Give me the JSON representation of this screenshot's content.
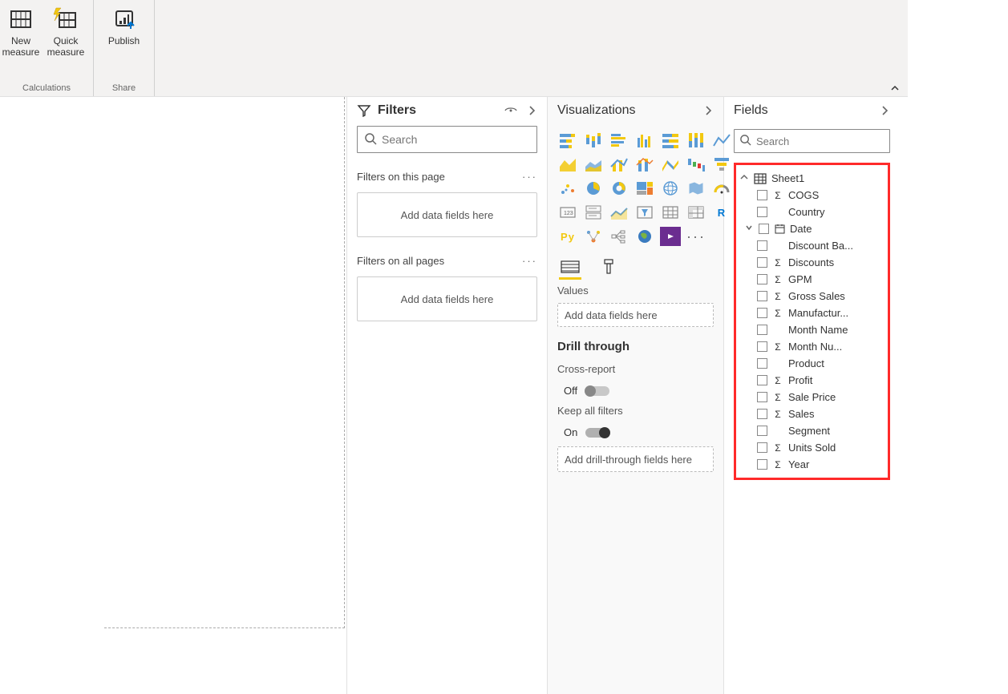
{
  "ribbon": {
    "calculations_group": "Calculations",
    "share_group": "Share",
    "new_measure": "New measure",
    "new_measure_line1": "New",
    "new_measure_line2": "measure",
    "quick_measure": "Quick\nmeasure",
    "publish": "Publish"
  },
  "filters": {
    "title": "Filters",
    "search_placeholder": "Search",
    "on_this_page": "Filters on this page",
    "on_all_pages": "Filters on all pages",
    "dropzone_text": "Add data fields here"
  },
  "visualizations": {
    "title": "Visualizations",
    "values_label": "Values",
    "values_drop": "Add data fields here",
    "drillthrough_title": "Drill through",
    "cross_report": "Cross-report",
    "cross_report_state": "Off",
    "keep_all_filters": "Keep all filters",
    "keep_all_filters_state": "On",
    "drill_drop": "Add drill-through fields here",
    "icons": [
      {
        "name": "stacked-bar-chart",
        "svg": "sbar"
      },
      {
        "name": "stacked-column-chart",
        "svg": "scol"
      },
      {
        "name": "clustered-bar-chart",
        "svg": "cbar"
      },
      {
        "name": "clustered-column-chart",
        "svg": "ccol"
      },
      {
        "name": "100-stacked-bar-chart",
        "svg": "sbar100"
      },
      {
        "name": "100-stacked-column-chart",
        "svg": "scol100"
      },
      {
        "name": "line-chart",
        "svg": "line"
      },
      {
        "name": "area-chart",
        "svg": "area"
      },
      {
        "name": "stacked-area-chart",
        "svg": "sarea"
      },
      {
        "name": "line-clustered-column",
        "svg": "linecol"
      },
      {
        "name": "line-stacked-column",
        "svg": "linescol"
      },
      {
        "name": "ribbon-chart",
        "svg": "ribbon"
      },
      {
        "name": "waterfall-chart",
        "svg": "waterfall"
      },
      {
        "name": "funnel-chart",
        "svg": "funnel"
      },
      {
        "name": "scatter-chart",
        "svg": "scatter"
      },
      {
        "name": "pie-chart",
        "svg": "pie"
      },
      {
        "name": "donut-chart",
        "svg": "donut"
      },
      {
        "name": "treemap",
        "svg": "treemap"
      },
      {
        "name": "map",
        "svg": "globe"
      },
      {
        "name": "filled-map",
        "svg": "filledmap"
      },
      {
        "name": "gauge",
        "svg": "gauge"
      },
      {
        "name": "card",
        "svg": "card"
      },
      {
        "name": "multi-row-card",
        "svg": "mrcard"
      },
      {
        "name": "kpi",
        "svg": "kpi"
      },
      {
        "name": "slicer",
        "svg": "slicer"
      },
      {
        "name": "table",
        "svg": "table"
      },
      {
        "name": "matrix",
        "svg": "matrix"
      },
      {
        "name": "r-visual",
        "svg": "R"
      },
      {
        "name": "python-visual",
        "svg": "Py"
      },
      {
        "name": "key-influencers",
        "svg": "keyinf"
      },
      {
        "name": "decomposition-tree",
        "svg": "decomp"
      },
      {
        "name": "arcgis-map",
        "svg": "arcgis"
      },
      {
        "name": "power-apps",
        "svg": "papps",
        "selected": true
      },
      {
        "name": "more-visuals",
        "svg": "more"
      }
    ]
  },
  "fields": {
    "title": "Fields",
    "search_placeholder": "Search",
    "table_name": "Sheet1",
    "items": [
      {
        "name": "COGS",
        "sigma": true
      },
      {
        "name": "Country",
        "sigma": false
      },
      {
        "name": "Date",
        "sigma": false,
        "hierarchy": true,
        "expanded": false,
        "type": "date"
      },
      {
        "name": "Discount Ba...",
        "sigma": false
      },
      {
        "name": "Discounts",
        "sigma": true
      },
      {
        "name": "GPM",
        "sigma": true
      },
      {
        "name": "Gross Sales",
        "sigma": true
      },
      {
        "name": "Manufactur...",
        "sigma": true
      },
      {
        "name": "Month Name",
        "sigma": false
      },
      {
        "name": "Month Nu...",
        "sigma": true
      },
      {
        "name": "Product",
        "sigma": false
      },
      {
        "name": "Profit",
        "sigma": true
      },
      {
        "name": "Sale Price",
        "sigma": true
      },
      {
        "name": "Sales",
        "sigma": true
      },
      {
        "name": "Segment",
        "sigma": false
      },
      {
        "name": "Units Sold",
        "sigma": true
      },
      {
        "name": "Year",
        "sigma": true
      }
    ]
  }
}
